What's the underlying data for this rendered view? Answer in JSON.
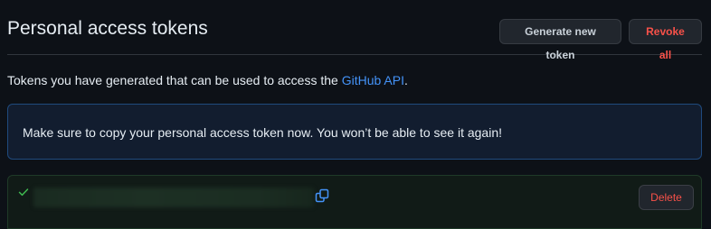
{
  "header": {
    "title": "Personal access tokens",
    "generate_label": "Generate new token",
    "revoke_label": "Revoke all"
  },
  "intro": {
    "text_before": "Tokens you have generated that can be used to access the ",
    "link_text": "GitHub API",
    "text_after": "."
  },
  "flash": {
    "message": "Make sure to copy your personal access token now. You won’t be able to see it again!"
  },
  "token": {
    "value": "",
    "status_icon": "check-icon",
    "copy_icon": "copy-icon",
    "delete_label": "Delete"
  },
  "colors": {
    "background": "#0d1117",
    "link": "#4493f8",
    "danger": "#f85149",
    "success": "#3fb950",
    "flash_bg": "#121d2f",
    "flash_border": "#1f4a7d"
  }
}
